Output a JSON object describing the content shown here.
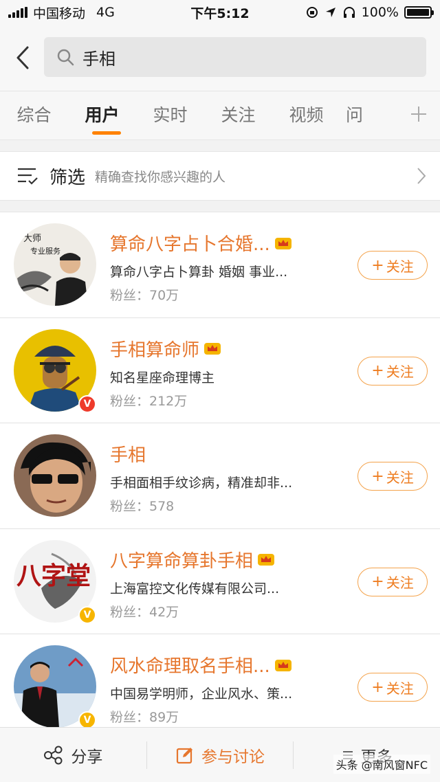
{
  "status_bar": {
    "carrier": "中国移动",
    "network": "4G",
    "time": "下午5:12",
    "battery": "100%"
  },
  "search": {
    "query": "手相"
  },
  "tabs": [
    {
      "label": "综合"
    },
    {
      "label": "用户"
    },
    {
      "label": "实时"
    },
    {
      "label": "关注"
    },
    {
      "label": "视频"
    },
    {
      "label": "问"
    }
  ],
  "filter": {
    "title": "筛选",
    "subtitle": "精确查找你感兴趣的人"
  },
  "users": [
    {
      "name": "算命八字占卜合婚...",
      "desc": "算命八字占卜算卦 婚姻 事业...",
      "fans": "粉丝：70万",
      "follow": "关注",
      "avatar_text": [
        "大师",
        "专业服务"
      ]
    },
    {
      "name": "手相算命师",
      "desc": "知名星座命理博主",
      "fans": "粉丝：212万",
      "follow": "关注"
    },
    {
      "name": "手相",
      "desc": "手相面相手纹诊病，精准却非...",
      "fans": "粉丝：578",
      "follow": "关注"
    },
    {
      "name": "八字算命算卦手相",
      "desc": "上海富控文化传媒有限公司...",
      "fans": "粉丝：42万",
      "follow": "关注",
      "avatar_text": "八字堂"
    },
    {
      "name": "风水命理取名手相...",
      "desc": "中国易学明师，企业风水、策...",
      "fans": "粉丝：89万",
      "follow": "关注"
    }
  ],
  "bottom_bar": {
    "share": "分享",
    "discuss": "参与讨论",
    "more": "更多"
  },
  "watermark": "头条 @南风窗NFC",
  "colors": {
    "accent": "#ff8200",
    "name": "#e6762d",
    "verified_yellow": "#f7b500",
    "verified_red": "#ee3b2b"
  }
}
